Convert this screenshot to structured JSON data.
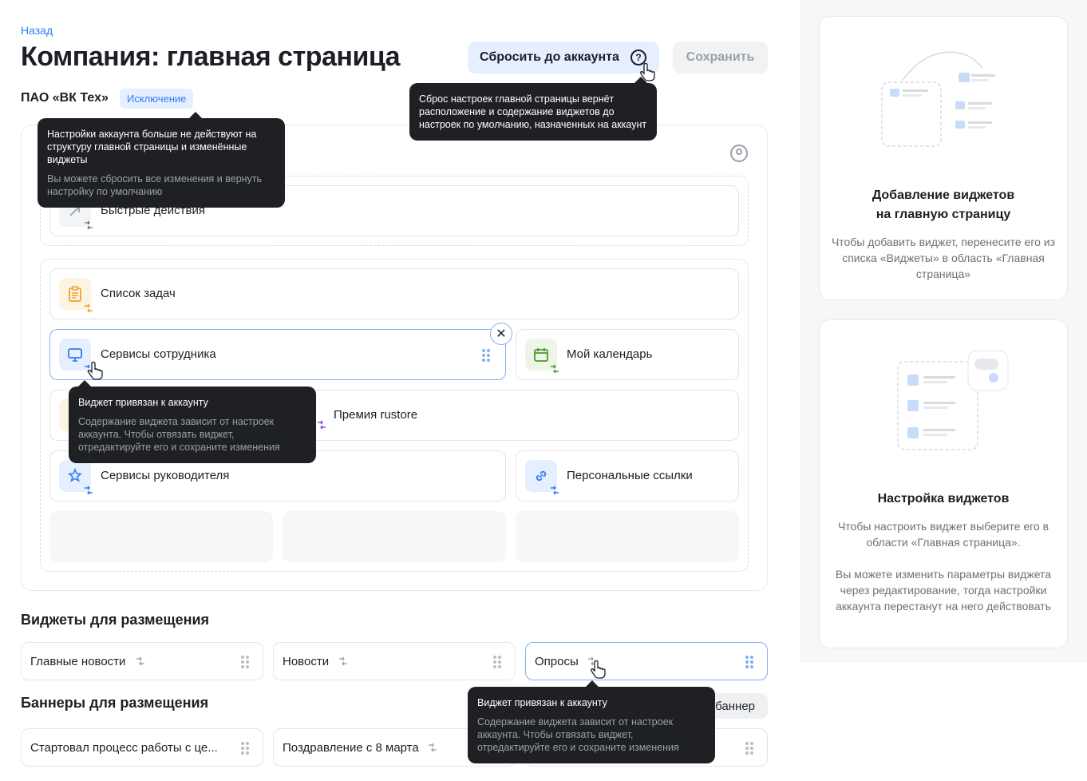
{
  "header": {
    "back_label": "Назад",
    "title": "Компания: главная страница",
    "reset_label": "Сбросить до аккаунта",
    "save_label": "Сохранить",
    "help_icon": "?"
  },
  "company": {
    "name": "ПАО «ВК Тех»",
    "badge": "Исключение"
  },
  "tooltips": {
    "account": {
      "title": "Настройки аккаунта больше не действуют на структуру главной страницы и изменённые виджеты",
      "sub": "Вы можете сбросить все изменения и вернуть настройку по умолчанию"
    },
    "reset": {
      "title": "Сброс настроек главной страницы вернёт расположение и содержание виджетов до настроек по умолчанию, назначенных на аккаунт"
    },
    "widget_linked": {
      "title": "Виджет привязан к аккаунту",
      "sub": "Содержание виджета зависит от настроек аккаунта. Чтобы отвязать виджет, отредактируйте его и сохраните изменения"
    }
  },
  "canvas": {
    "widgets": [
      {
        "label": "Быстрые действия",
        "icon": "arrow-icon"
      },
      {
        "label": "Список задач",
        "icon": "clipboard-icon"
      },
      {
        "label": "Сервисы сотрудника",
        "icon": "monitor-icon"
      },
      {
        "label": "Мой календарь",
        "icon": "calendar-icon"
      },
      {
        "label": "Премия rustore",
        "icon": "gift-icon"
      },
      {
        "label": "Сервисы руководителя",
        "icon": "star-person-icon"
      },
      {
        "label": "Персональные ссылки",
        "icon": "link-icon"
      }
    ]
  },
  "widgets_section": {
    "title": "Виджеты для размещения",
    "items": [
      "Главные новости",
      "Новости",
      "Опросы"
    ]
  },
  "banners_section": {
    "title": "Баннеры для размещения",
    "add_label": "баннер",
    "items": [
      "Стартовал процесс работы с це...",
      "Поздравление с 8 марта"
    ]
  },
  "info": {
    "add": {
      "title_line1": "Добавление виджетов",
      "title_line2": "на главную страницу",
      "text": "Чтобы добавить виджет, перенесите его из списка «Виджеты» в область «Главная страница»"
    },
    "setup": {
      "title": "Настройка виджетов",
      "text1": "Чтобы настроить виджет выберите его в области «Главная страница».",
      "text2": "Вы можете изменить параметры виджета через редактирование, тогда настройки аккаунта перестанут на него действовать"
    }
  },
  "colors": {
    "accent": "#2f7cf6",
    "tooltip_bg": "#1f2024",
    "orange": "#f0a22b",
    "green": "#4a9a2c",
    "purple": "#8c52e8"
  }
}
